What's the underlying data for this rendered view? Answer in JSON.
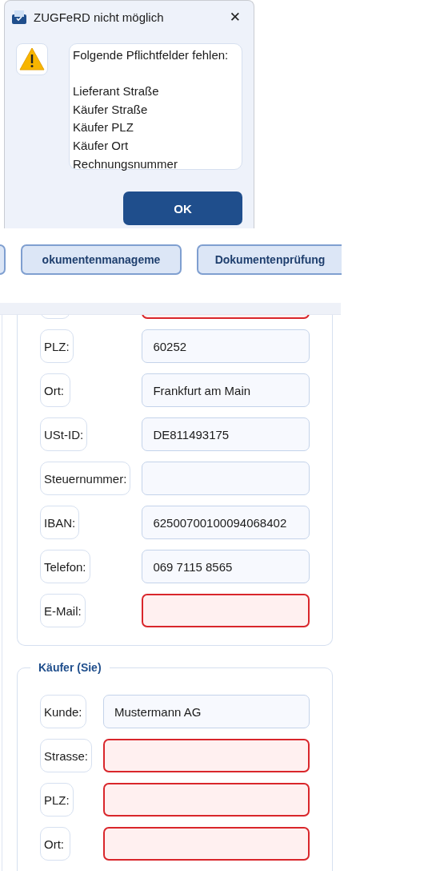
{
  "dialog": {
    "title": "ZUGFeRD nicht möglich",
    "close": "✕",
    "message": {
      "heading": "Folgende Pflichtfelder fehlen:",
      "items": [
        "Lieferant Straße",
        "Käufer Straße",
        "Käufer PLZ",
        "Käufer Ort",
        "Rechnungsnummer"
      ]
    },
    "button": "OK"
  },
  "tabs": [
    {
      "label": "okumentenmanageme"
    },
    {
      "label": "Dokumentenprüfung"
    }
  ],
  "sections": [
    {
      "rows": [
        {
          "invalid": true
        },
        {
          "label": "PLZ:",
          "value": "60252",
          "invalid": false
        },
        {
          "label": "Ort:",
          "value": "Frankfurt am Main",
          "invalid": false
        },
        {
          "label": "USt-ID:",
          "value": "DE811493175",
          "invalid": false
        },
        {
          "label": "Steuernummer:",
          "invalid": false
        },
        {
          "label": "IBAN:",
          "value": "62500700100094068402",
          "invalid": false
        },
        {
          "label": "Telefon:",
          "value": "069 7115 8565",
          "invalid": false
        },
        {
          "label": "E-Mail:",
          "invalid": true
        }
      ]
    },
    {
      "title": "Käufer (Sie)",
      "rows": [
        {
          "label": "Kunde:",
          "value": "Mustermann AG",
          "invalid": false
        },
        {
          "label": "Strasse:",
          "invalid": true
        },
        {
          "label": "PLZ:",
          "invalid": true
        },
        {
          "label": "Ort:",
          "invalid": true
        }
      ]
    }
  ]
}
